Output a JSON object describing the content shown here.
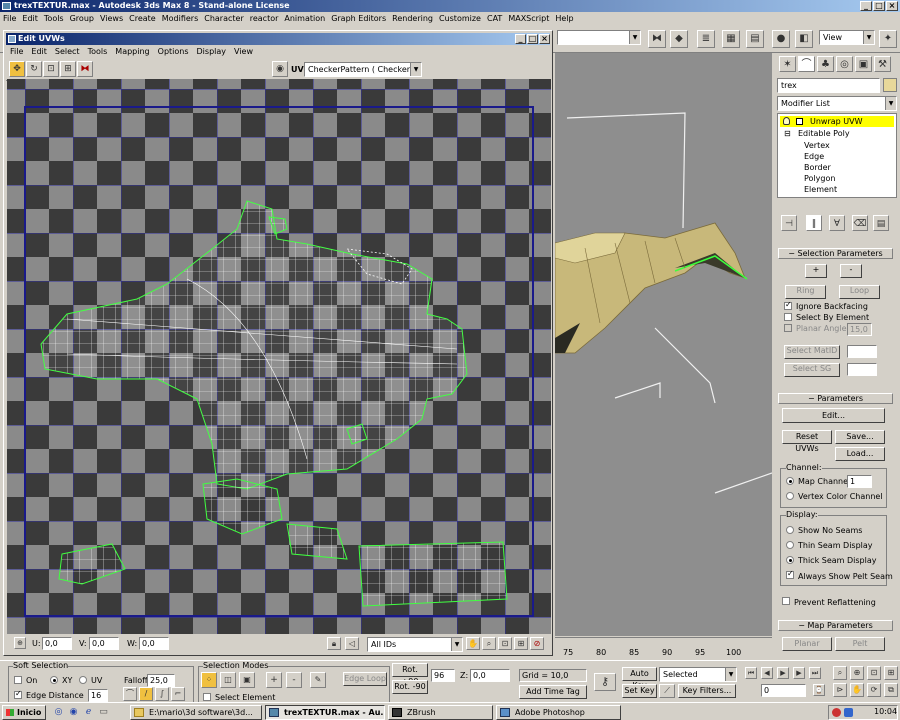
{
  "app": {
    "title": "trexTEXTUR.max - Autodesk 3ds Max 8   - Stand-alone License"
  },
  "menu": [
    "File",
    "Edit",
    "Tools",
    "Group",
    "Views",
    "Create",
    "Modifiers",
    "Character",
    "reactor",
    "Animation",
    "Graph Editors",
    "Rendering",
    "Customize",
    "CAT",
    "MAXScript",
    "Help"
  ],
  "toolbar": {
    "view_dropdown": "View"
  },
  "uvw": {
    "title": "Edit UVWs",
    "menu": [
      "File",
      "Edit",
      "Select",
      "Tools",
      "Mapping",
      "Options",
      "Display",
      "View"
    ],
    "uv_label": "UV",
    "texture_dropdown": "CheckerPattern  ( Checker )",
    "status": {
      "u_label": "U:",
      "u_value": "0,0",
      "v_label": "V:",
      "v_value": "0,0",
      "w_label": "W:",
      "w_value": "0,0",
      "ids": "All IDs"
    }
  },
  "command_panel": {
    "object_name": "trex",
    "modifier_list": "Modifier List",
    "stack": [
      "Unwrap UVW",
      "Editable Poly",
      "Vertex",
      "Edge",
      "Border",
      "Polygon",
      "Element"
    ],
    "selection_params": {
      "header": "Selection Parameters",
      "plus": "+",
      "minus": "-",
      "ring": "Ring",
      "loop": "Loop",
      "ignore_backfacing": "Ignore Backfacing",
      "select_by_element": "Select By Element",
      "planar_angle": "Planar Angle",
      "planar_value": "15,0",
      "select_matid": "Select MatID",
      "select_sg": "Select SG"
    },
    "parameters": {
      "header": "Parameters",
      "edit": "Edit...",
      "reset": "Reset UVWs",
      "save": "Save...",
      "load": "Load...",
      "channel_label": "Channel:",
      "map_channel": "Map Channel:",
      "map_channel_value": "1",
      "vertex_color": "Vertex Color Channel",
      "display_label": "Display:",
      "show_no_seams": "Show No Seams",
      "thin_seam": "Thin Seam Display",
      "thick_seam": "Thick Seam Display",
      "always_pelt": "Always Show Pelt Seam",
      "prevent_reflattening": "Prevent Reflattening"
    },
    "map_params": {
      "header": "Map Parameters",
      "planar": "Planar",
      "pelt": "Pelt"
    }
  },
  "timeline": {
    "ticks": [
      "75",
      "80",
      "85",
      "90",
      "95",
      "100"
    ]
  },
  "bottom": {
    "soft_selection": "Soft Selection",
    "on": "On",
    "xy": "XY",
    "uv": "UV",
    "falloff": "Falloff",
    "falloff_value": "25,0",
    "edge_distance": "Edge Distance",
    "edge_distance_value": "16",
    "selection_modes": "Selection Modes",
    "edge_loop": "Edge Loop",
    "select_element": "Select Element",
    "rot_p90": "Rot. +90",
    "rot_m90": "Rot. -90",
    "coord_value": "96",
    "z_label": "Z:",
    "z_value": "0,0",
    "grid": "Grid = 10,0",
    "add_time_tag": "Add Time Tag",
    "auto_key": "Auto Key",
    "selected": "Selected",
    "set_key": "Set Key",
    "key_filters": "Key Filters...",
    "frame": "0"
  },
  "taskbar": {
    "start": "Inicio",
    "items": [
      "E:\\mario\\3d software\\3d...",
      "trexTEXTUR.max - Au...",
      "ZBrush",
      "Adobe Photoshop"
    ],
    "time": "10:04"
  }
}
